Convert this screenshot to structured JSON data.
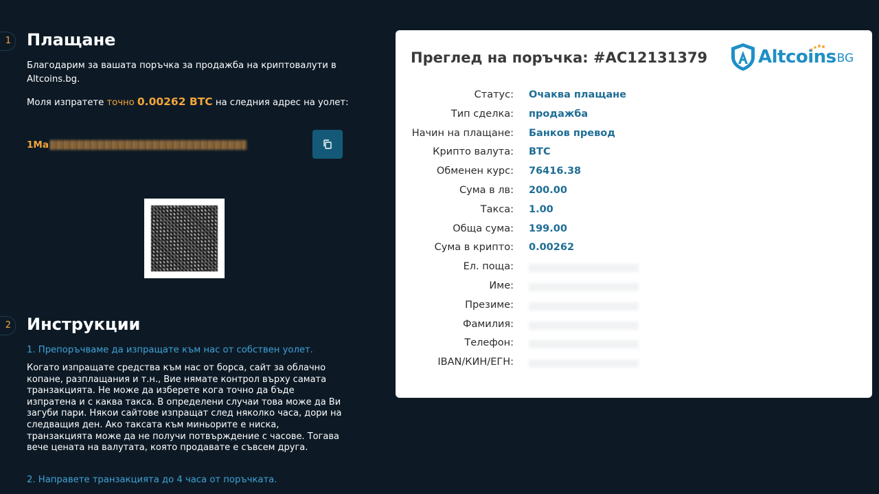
{
  "payment": {
    "step_number": "1",
    "title": "Плащане",
    "thanks_text": "Благодарим за вашата поръчка за продажба на криптовалути в Altcoins.bg.",
    "send_prefix": "Моля изпратете ",
    "send_exact": "точно",
    "send_amount": "0.00262 BTC",
    "send_suffix": " на следния адрес на уолет:",
    "address_prefix": "1Ma"
  },
  "instructions": {
    "step_number": "2",
    "title": "Инструкции",
    "item1_title": "1. Препоръчваме да изпращате към нас от собствен уолет.",
    "item1_text": "Когато изпращате средства към нас от борса, сайт за облачно копане, разплащания и т.н., Вие нямате контрол върху самата транзакцията. Не може да изберете кога точно да бъде изпратена и с каква такса. В определени случаи това може да Ви загуби пари. Някои сайтове изпращат след няколко часа, дори на следващия ден. Ако таксата към миньорите е ниска, транзакцията може да не получи потвърждение с часове. Тогава вече цената на валутата, която продавате е съвсем друга.",
    "item2_title": "2. Направете транзакцията до 4 часа от поръчката."
  },
  "order": {
    "title": "Преглед на поръчка: #AC12131379",
    "logo": {
      "name": "Altcoins",
      "suffix": "BG",
      "icon": "shield-a-icon"
    },
    "rows": [
      {
        "label": "Статус:",
        "value": "Очаква плащане"
      },
      {
        "label": "Тип сделка:",
        "value": "продажба"
      },
      {
        "label": "Начин на плащане:",
        "value": "Банков превод"
      },
      {
        "label": "Крипто валута:",
        "value": "BTC"
      },
      {
        "label": "Обменен курс:",
        "value": "76416.38"
      },
      {
        "label": "Сума в лв:",
        "value": "200.00"
      },
      {
        "label": "Такса:",
        "value": "1.00"
      },
      {
        "label": "Обща сума:",
        "value": "199.00"
      },
      {
        "label": "Сума в крипто:",
        "value": "0.00262"
      },
      {
        "label": "Ел. поща:",
        "value": ""
      },
      {
        "label": "Име:",
        "value": ""
      },
      {
        "label": "Презиме:",
        "value": ""
      },
      {
        "label": "Фамилия:",
        "value": ""
      },
      {
        "label": "Телефон:",
        "value": ""
      },
      {
        "label": "IBAN/КИН/ЕГН:",
        "value": ""
      }
    ]
  },
  "colors": {
    "background": "#0d1a26",
    "accent_orange": "#f3a53a",
    "accent_blue": "#3fa2d6",
    "value_blue": "#1f6d95",
    "button": "#145a78"
  },
  "icons": {
    "copy": "copy-icon",
    "qr": "qr-code-icon"
  }
}
